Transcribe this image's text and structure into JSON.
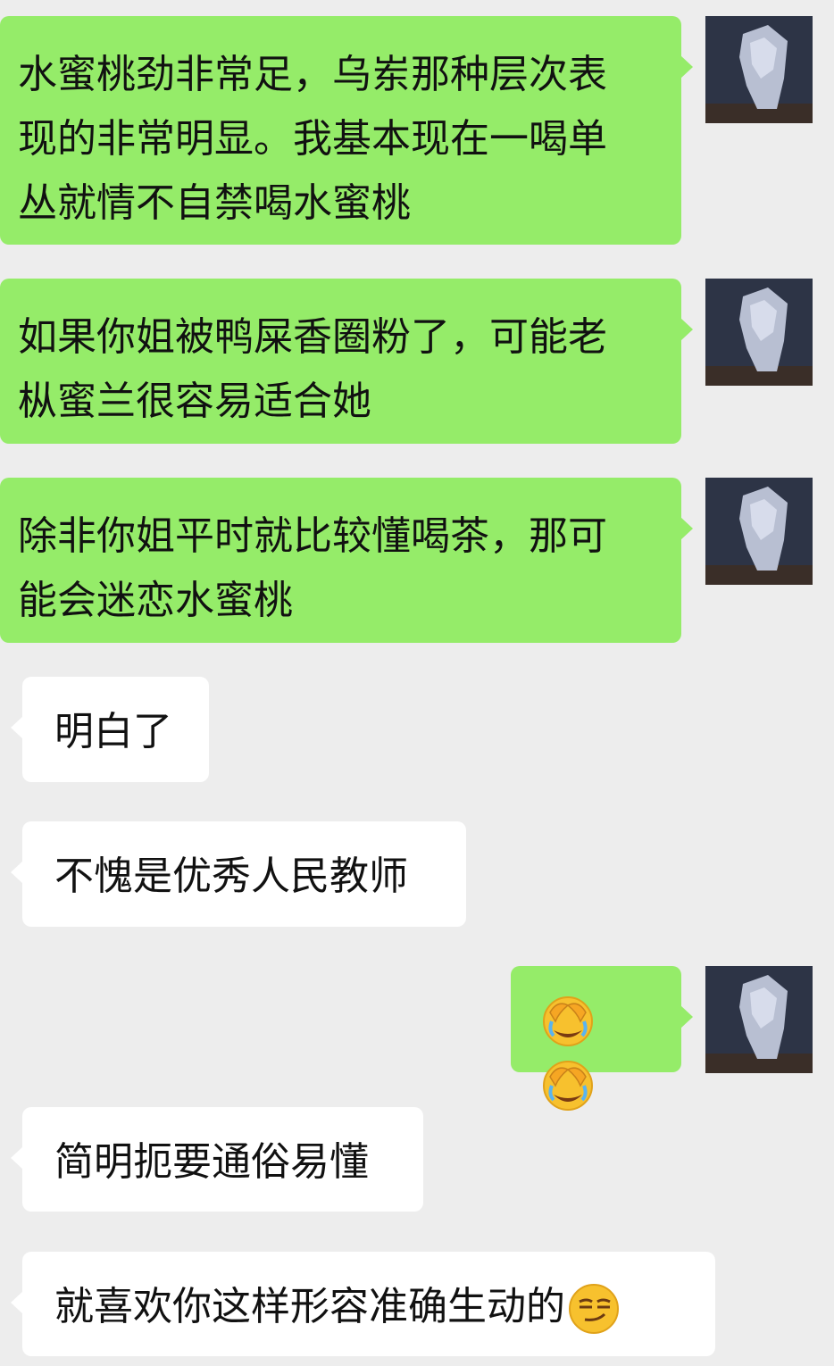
{
  "messages": [
    {
      "side": "out",
      "lines": [
        "水蜜桃劲非常足，乌岽那种层次表",
        "现的非常明显。我基本现在一喝单",
        "丛就情不自禁喝水蜜桃"
      ]
    },
    {
      "side": "out",
      "lines": [
        "如果你姐被鸭屎香圈粉了，可能老",
        "枞蜜兰很容易适合她"
      ]
    },
    {
      "side": "out",
      "lines": [
        "除非你姐平时就比较懂喝茶，那可",
        "能会迷恋水蜜桃"
      ]
    },
    {
      "side": "in",
      "text": "明白了"
    },
    {
      "side": "in",
      "text": "不愧是优秀人民教师"
    },
    {
      "side": "out",
      "emojis": [
        "facepalm-crying-emoji",
        "facepalm-crying-emoji"
      ]
    },
    {
      "side": "in",
      "text": "简明扼要通俗易懂"
    },
    {
      "side": "in",
      "text": "就喜欢你这样形容准确生动的",
      "emoji": "smirk-emoji"
    }
  ],
  "colors": {
    "background": "#ededed",
    "outgoing_bubble": "#95ec69",
    "incoming_bubble": "#ffffff",
    "text": "#111111"
  }
}
